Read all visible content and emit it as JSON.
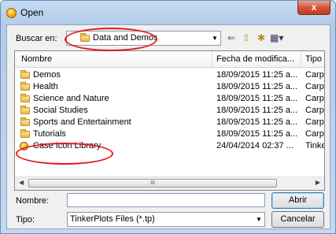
{
  "window": {
    "title": "Open",
    "close_glyph": "x"
  },
  "lookin": {
    "label": "Buscar en:",
    "value": "Data and Demos"
  },
  "toolbar": {
    "back": "⇐",
    "up": "⇧",
    "new_folder": "✱",
    "views": "▦▾"
  },
  "list": {
    "columns": [
      "Nombre",
      "Fecha de modifica...",
      "Tipo"
    ],
    "rows": [
      {
        "name": "Demos",
        "date": "18/09/2015 11:25 a...",
        "type": "Carpeta",
        "icon": "folder-icon"
      },
      {
        "name": "Health",
        "date": "18/09/2015 11:25 a...",
        "type": "Carpeta",
        "icon": "folder-icon"
      },
      {
        "name": "Science and Nature",
        "date": "18/09/2015 11:25 a...",
        "type": "Carpeta",
        "icon": "folder-icon"
      },
      {
        "name": "Social Studies",
        "date": "18/09/2015 11:25 a...",
        "type": "Carpeta",
        "icon": "folder-icon"
      },
      {
        "name": "Sports and Entertainment",
        "date": "18/09/2015 11:25 a...",
        "type": "Carpeta",
        "icon": "folder-icon"
      },
      {
        "name": "Tutorials",
        "date": "18/09/2015 11:25 a...",
        "type": "Carpeta",
        "icon": "folder-icon"
      },
      {
        "name": "Case Icon Library",
        "date": "24/04/2014 02:37 ...",
        "type": "TinkerPl",
        "icon": "tinkerplots-file-icon"
      }
    ],
    "scroll_thumb_grip": "III"
  },
  "filename": {
    "label": "Nombre:",
    "value": ""
  },
  "filetype": {
    "label": "Tipo:",
    "value": "TinkerPlots Files (*.tp)"
  },
  "buttons": {
    "open": "Abrir",
    "cancel": "Cancelar"
  },
  "annotation_color": "#e21b1b"
}
